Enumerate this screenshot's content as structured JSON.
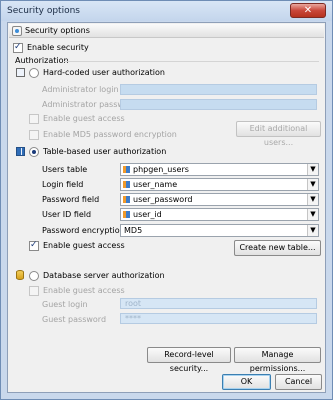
{
  "window": {
    "title": "Security options",
    "close_label": "✕"
  },
  "header": {
    "label": "Security options"
  },
  "enable_security": {
    "label": "Enable security",
    "checked": true
  },
  "authorization": {
    "group_label": "Authorization"
  },
  "hardcoded": {
    "label": "Hard-coded user authorization",
    "admin_login_label": "Administrator login",
    "admin_password_label": "Administrator password",
    "enable_guest_label": "Enable guest access",
    "md5_label": "Enable MD5 password encryption",
    "edit_users_label": "Edit additional users..."
  },
  "table_based": {
    "label": "Table-based user authorization",
    "users_table_label": "Users table",
    "users_table_value": "phpgen_users",
    "login_field_label": "Login field",
    "login_field_value": "user_name",
    "password_field_label": "Password field",
    "password_field_value": "user_password",
    "user_id_field_label": "User ID field",
    "user_id_field_value": "user_id",
    "password_encryption_label": "Password encryption",
    "password_encryption_value": "MD5",
    "enable_guest_label": "Enable guest access",
    "create_table_label": "Create new table..."
  },
  "database_server": {
    "label": "Database server authorization",
    "enable_guest_label": "Enable guest access",
    "guest_login_label": "Guest login",
    "guest_login_value": "root",
    "guest_password_label": "Guest password",
    "guest_password_value": "****"
  },
  "buttons": {
    "record_level": "Record-level security...",
    "manage_permissions": "Manage permissions...",
    "ok": "OK",
    "cancel": "Cancel"
  }
}
